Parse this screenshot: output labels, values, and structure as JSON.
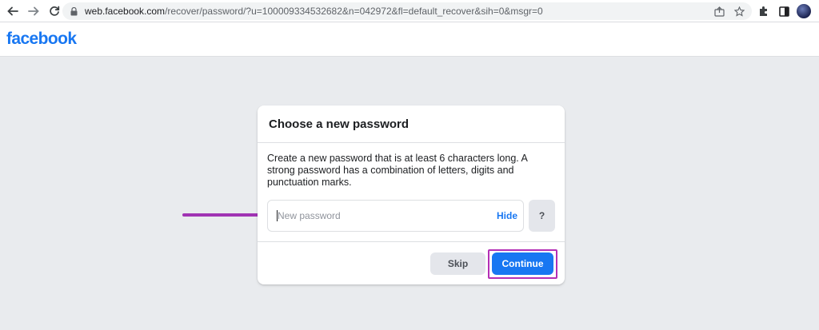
{
  "browser": {
    "url_host": "web.facebook.com",
    "url_path": "/recover/password/?u=100009334532682&n=042972&fl=default_recover&sih=0&msgr=0"
  },
  "header": {
    "logo": "facebook"
  },
  "dialog": {
    "title": "Choose a new password",
    "description": "Create a new password that is at least 6 characters long. A strong password has a combination of letters, digits and punctuation marks.",
    "password_placeholder": "New password",
    "hide_label": "Hide",
    "help_label": "?",
    "skip_label": "Skip",
    "continue_label": "Continue"
  },
  "colors": {
    "brand": "#1877f2",
    "annotation": "#a033b3",
    "background": "#e9ebee"
  },
  "icons": {
    "back": "arrow-left-icon",
    "forward": "arrow-right-icon",
    "reload": "reload-icon",
    "lock": "lock-icon",
    "share": "share-icon",
    "bookmark": "star-icon",
    "extensions": "puzzle-icon",
    "sidepanel": "sidepanel-icon",
    "profile": "avatar"
  }
}
